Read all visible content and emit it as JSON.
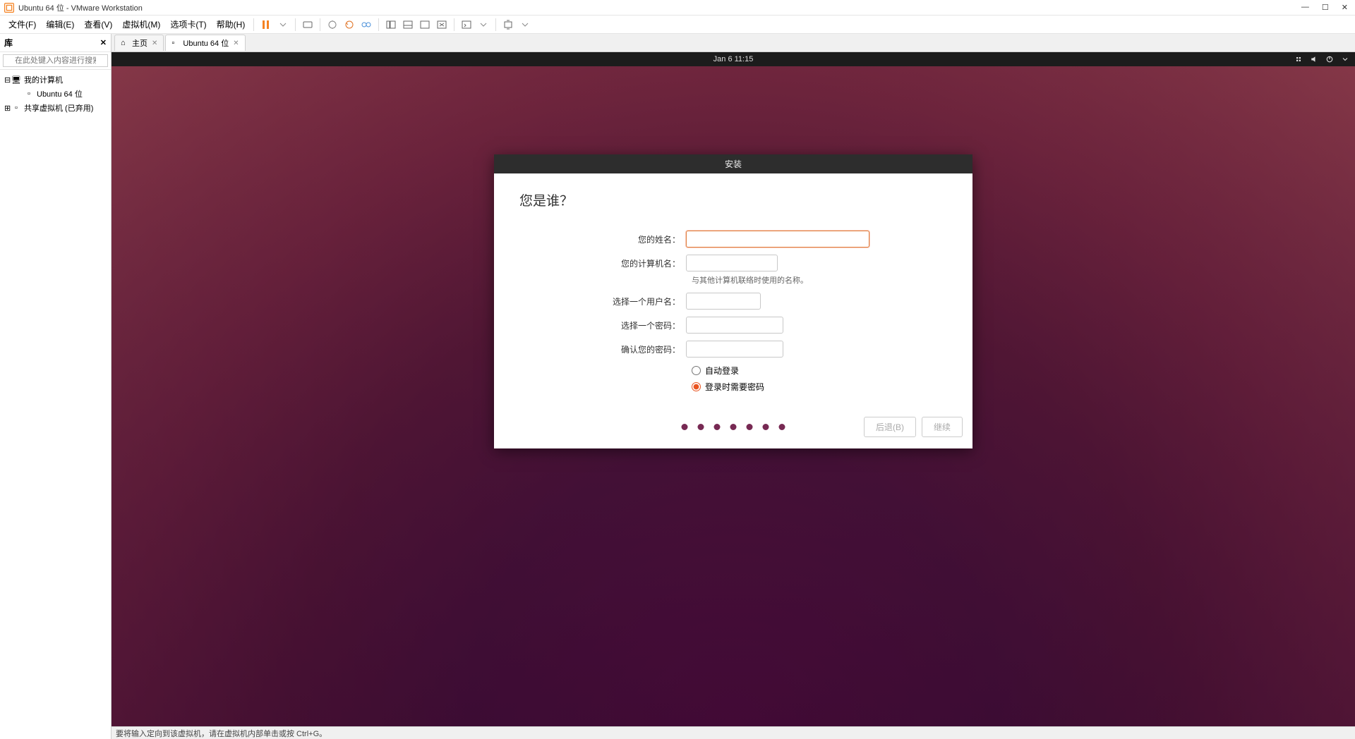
{
  "window": {
    "title": "Ubuntu 64 位 - VMware Workstation"
  },
  "menu": {
    "items": [
      "文件(F)",
      "编辑(E)",
      "查看(V)",
      "虚拟机(M)",
      "选项卡(T)",
      "帮助(H)"
    ]
  },
  "sidebar": {
    "title": "库",
    "search_placeholder": "在此处键入内容进行搜索",
    "root": "我的计算机",
    "items": [
      "Ubuntu 64 位",
      "共享虚拟机 (已弃用)"
    ]
  },
  "tabs": {
    "home": "主页",
    "vm": "Ubuntu 64 位"
  },
  "ubuntu_bar": {
    "datetime": "Jan 6  11:15"
  },
  "installer": {
    "title": "安装",
    "heading": "您是谁？",
    "labels": {
      "name": "您的姓名：",
      "computer": "您的计算机名：",
      "computer_hint": "与其他计算机联络时使用的名称。",
      "username": "选择一个用户名：",
      "password": "选择一个密码：",
      "confirm": "确认您的密码："
    },
    "radios": {
      "auto": "自动登录",
      "pass": "登录时需要密码"
    },
    "buttons": {
      "back": "后退(B)",
      "continue": "继续"
    }
  },
  "status": {
    "text": "要将输入定向到该虚拟机，请在虚拟机内部单击或按 Ctrl+G。"
  }
}
